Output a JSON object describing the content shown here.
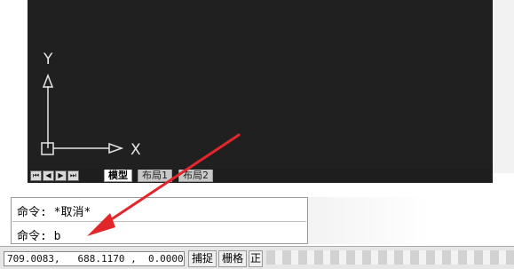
{
  "ucs": {
    "y_label": "Y",
    "x_label": "X"
  },
  "layout_tabs": {
    "nav_buttons": [
      "⏮",
      "◀",
      "▶",
      "⏭"
    ],
    "tabs": [
      {
        "label": "模型",
        "active": true
      },
      {
        "label": "布局1",
        "active": false
      },
      {
        "label": "布局2",
        "active": false
      }
    ]
  },
  "command": {
    "history_line": "命令: *取消*",
    "current_line": "命令: b"
  },
  "status": {
    "coordinates": "709.0083,   688.1170 ,  0.0000",
    "snap_label": "捕捉",
    "grid_label": "栅格",
    "ortho_label": "正"
  },
  "colors": {
    "canvas_bg": "#202020",
    "annotation_arrow": "#e3262c"
  }
}
